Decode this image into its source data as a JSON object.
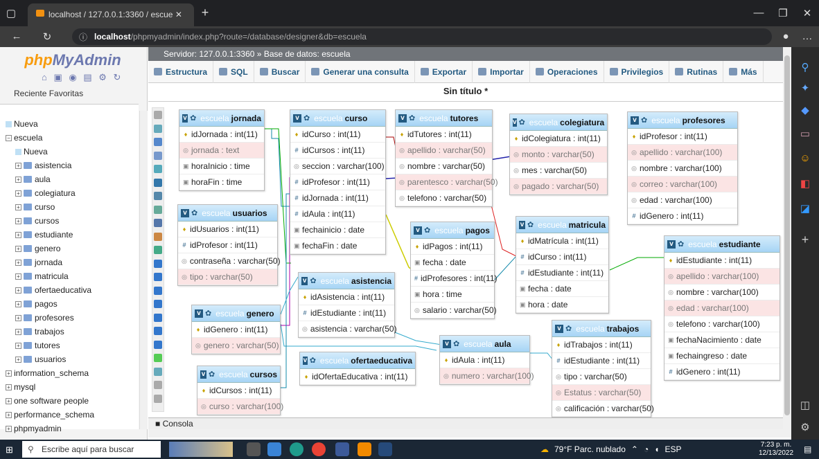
{
  "browser": {
    "tab_title": "localhost / 127.0.0.1:3360 / escue",
    "url_host": "localhost",
    "url_path": "/phpmyadmin/index.php?route=/database/designer&db=escuela"
  },
  "pma": {
    "logo_a": "php",
    "logo_b": "MyAdmin",
    "recent": "Reciente",
    "favorites": "Favoritas"
  },
  "nav": [
    {
      "label": "Nueva",
      "level": 0,
      "pm": "",
      "new": true
    },
    {
      "label": "escuela",
      "level": 0,
      "pm": "−"
    },
    {
      "label": "Nueva",
      "level": 1,
      "pm": "",
      "new": true
    },
    {
      "label": "asistencia",
      "level": 1,
      "pm": "+"
    },
    {
      "label": "aula",
      "level": 1,
      "pm": "+"
    },
    {
      "label": "colegiatura",
      "level": 1,
      "pm": "+"
    },
    {
      "label": "curso",
      "level": 1,
      "pm": "+"
    },
    {
      "label": "cursos",
      "level": 1,
      "pm": "+"
    },
    {
      "label": "estudiante",
      "level": 1,
      "pm": "+"
    },
    {
      "label": "genero",
      "level": 1,
      "pm": "+"
    },
    {
      "label": "jornada",
      "level": 1,
      "pm": "+"
    },
    {
      "label": "matricula",
      "level": 1,
      "pm": "+"
    },
    {
      "label": "ofertaeducativa",
      "level": 1,
      "pm": "+"
    },
    {
      "label": "pagos",
      "level": 1,
      "pm": "+"
    },
    {
      "label": "profesores",
      "level": 1,
      "pm": "+"
    },
    {
      "label": "trabajos",
      "level": 1,
      "pm": "+"
    },
    {
      "label": "tutores",
      "level": 1,
      "pm": "+"
    },
    {
      "label": "usuarios",
      "level": 1,
      "pm": "+"
    },
    {
      "label": "information_schema",
      "level": 0,
      "pm": "+"
    },
    {
      "label": "mysql",
      "level": 0,
      "pm": "+"
    },
    {
      "label": "one software people",
      "level": 0,
      "pm": "+"
    },
    {
      "label": "performance_schema",
      "level": 0,
      "pm": "+"
    },
    {
      "label": "phpmyadmin",
      "level": 0,
      "pm": "+"
    }
  ],
  "breadcrumb": {
    "server": "Servidor: 127.0.0.1:3360",
    "sep": "»",
    "db": "Base de datos: escuela"
  },
  "menu": [
    "Estructura",
    "SQL",
    "Buscar",
    "Generar una consulta",
    "Exportar",
    "Importar",
    "Operaciones",
    "Privilegios",
    "Rutinas",
    "Más"
  ],
  "designer_title": "Sin título *",
  "db_prefix": "escuela",
  "tables": [
    {
      "name": "jornada",
      "rows": [
        [
          "pk",
          "idJornada : int(11)"
        ],
        [
          "n",
          "jornada : text"
        ],
        [
          "t",
          "horaInicio : time"
        ],
        [
          "t",
          "horaFin : time"
        ]
      ]
    },
    {
      "name": "curso",
      "rows": [
        [
          "pk",
          "idCurso : int(11)"
        ],
        [
          "fk",
          "idCursos : int(11)"
        ],
        [
          "n",
          "seccion : varchar(100)"
        ],
        [
          "fk",
          "idProfesor : int(11)"
        ],
        [
          "fk",
          "idJornada : int(11)"
        ],
        [
          "fk",
          "idAula : int(11)"
        ],
        [
          "t",
          "fechainicio : date"
        ],
        [
          "t",
          "fechaFin : date"
        ]
      ]
    },
    {
      "name": "tutores",
      "rows": [
        [
          "pk",
          "idTutores : int(11)"
        ],
        [
          "n",
          "apellido : varchar(50)"
        ],
        [
          "n",
          "nombre : varchar(50)"
        ],
        [
          "n",
          "parentesco : varchar(50)"
        ],
        [
          "n",
          "telefono : varchar(50)"
        ]
      ]
    },
    {
      "name": "colegiatura",
      "rows": [
        [
          "pk",
          "idColegiatura : int(11)"
        ],
        [
          "n",
          "monto : varchar(50)"
        ],
        [
          "n",
          "mes : varchar(50)"
        ],
        [
          "n",
          "pagado : varchar(50)"
        ]
      ]
    },
    {
      "name": "profesores",
      "rows": [
        [
          "pk",
          "idProfesor : int(11)"
        ],
        [
          "n",
          "apellido : varchar(100)"
        ],
        [
          "n",
          "nombre : varchar(100)"
        ],
        [
          "n",
          "correo : varchar(100)"
        ],
        [
          "n",
          "edad : varchar(100)"
        ],
        [
          "fk",
          "idGenero : int(11)"
        ]
      ]
    },
    {
      "name": "usuarios",
      "rows": [
        [
          "pk",
          "idUsuarios : int(11)"
        ],
        [
          "fk",
          "idProfesor : int(11)"
        ],
        [
          "n",
          "contraseña : varchar(50)"
        ],
        [
          "n",
          "tipo : varchar(50)"
        ]
      ]
    },
    {
      "name": "pagos",
      "rows": [
        [
          "pk",
          "idPagos : int(11)"
        ],
        [
          "t",
          "fecha : date"
        ],
        [
          "fk",
          "idProfesores : int(11)"
        ],
        [
          "t",
          "hora : time"
        ],
        [
          "n",
          "salario : varchar(50)"
        ]
      ]
    },
    {
      "name": "matricula",
      "rows": [
        [
          "pk",
          "idMatrícula : int(11)"
        ],
        [
          "fk",
          "idCurso : int(11)"
        ],
        [
          "fk",
          "idEstudiante : int(11)"
        ],
        [
          "t",
          "fecha : date"
        ],
        [
          "t",
          "hora : date"
        ]
      ]
    },
    {
      "name": "estudiante",
      "rows": [
        [
          "pk",
          "idEstudiante : int(11)"
        ],
        [
          "n",
          "apellido : varchar(100)"
        ],
        [
          "n",
          "nombre : varchar(100)"
        ],
        [
          "n",
          "edad : varchar(100)"
        ],
        [
          "n",
          "telefono : varchar(100)"
        ],
        [
          "t",
          "fechaNacimiento : date"
        ],
        [
          "t",
          "fechaingreso : date"
        ],
        [
          "fk",
          "idGenero : int(11)"
        ]
      ]
    },
    {
      "name": "asistencia",
      "rows": [
        [
          "pk",
          "idAsistencia : int(11)"
        ],
        [
          "fk",
          "idEstudiante : int(11)"
        ],
        [
          "n",
          "asistencia : varchar(50)"
        ]
      ]
    },
    {
      "name": "genero",
      "rows": [
        [
          "pk",
          "idGenero : int(11)"
        ],
        [
          "n",
          "genero : varchar(50)"
        ]
      ]
    },
    {
      "name": "aula",
      "rows": [
        [
          "pk",
          "idAula : int(11)"
        ],
        [
          "n",
          "numero : varchar(100)"
        ]
      ]
    },
    {
      "name": "trabajos",
      "rows": [
        [
          "pk",
          "idTrabajos : int(11)"
        ],
        [
          "fk",
          "idEstudiante : int(11)"
        ],
        [
          "n",
          "tipo : varchar(50)"
        ],
        [
          "n",
          "Estatus : varchar(50)"
        ],
        [
          "n",
          "calificación : varchar(50)"
        ]
      ]
    },
    {
      "name": "ofertaeducativa",
      "rows": [
        [
          "pk",
          "idOfertaEducativa : int(11)"
        ]
      ]
    },
    {
      "name": "cursos",
      "rows": [
        [
          "pk",
          "idCursos : int(11)"
        ],
        [
          "n",
          "curso : varchar(100)"
        ]
      ]
    }
  ],
  "console": "Consola",
  "taskbar": {
    "search_placeholder": "Escribe aquí para buscar",
    "weather": "79°F Parc. nublado",
    "lang": "ESP",
    "time": "7:23 p. m.",
    "date": "12/13/2022"
  }
}
